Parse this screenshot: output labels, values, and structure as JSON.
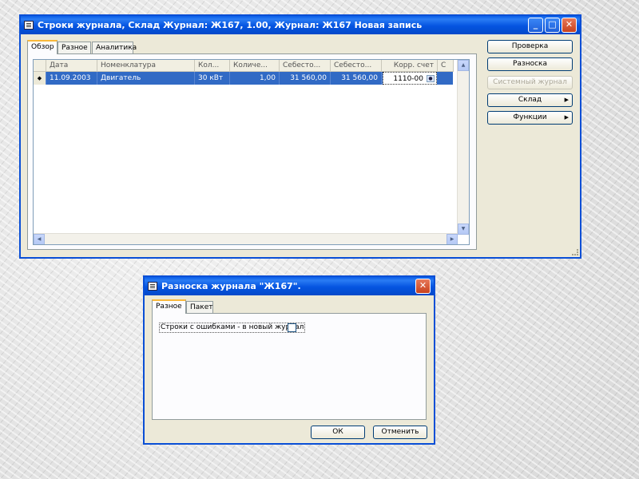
{
  "main_window": {
    "title": "Строки журнала, Склад   Журнал: Ж167, 1.00, Журнал: Ж167 Новая запись",
    "tabs": [
      {
        "label": "Обзор"
      },
      {
        "label": "Разное"
      },
      {
        "label": "Аналитика"
      }
    ],
    "grid": {
      "columns": [
        "Дата",
        "Номенклатура",
        "Кол...",
        "Количе...",
        "Себесто...",
        "Себесто...",
        "Корр. счет",
        "С"
      ],
      "row": {
        "marker": "◆",
        "date": "11.09.2003",
        "item": "Двигатель",
        "qty_unit": "30 кВт",
        "quantity": "1,00",
        "cost_price": "31 560,00",
        "cost_amount": "31 560,00",
        "account": "1110-00"
      }
    },
    "buttons": [
      {
        "label": "Проверка",
        "disabled": false
      },
      {
        "label": "Разноска",
        "disabled": false
      },
      {
        "label": "Системный журнал",
        "disabled": true
      },
      {
        "label": "Склад",
        "disabled": false,
        "submenu": true
      },
      {
        "label": "Функции",
        "disabled": false,
        "submenu": true
      }
    ]
  },
  "dialog": {
    "title": "Разноска журнала \"Ж167\".",
    "tabs": [
      {
        "label": "Разное"
      },
      {
        "label": "Пакет"
      }
    ],
    "checkbox_label": "Строки с ошибками - в новый журнал",
    "checkbox_checked": false,
    "ok_label": "ОК",
    "cancel_label": "Отменить"
  },
  "colors": {
    "titlebar": "#0a5fe8",
    "selection": "#316ac5",
    "window_bg": "#ece9d8",
    "active_tab_accent": "#f9b83a",
    "close_button": "#c8421e"
  }
}
